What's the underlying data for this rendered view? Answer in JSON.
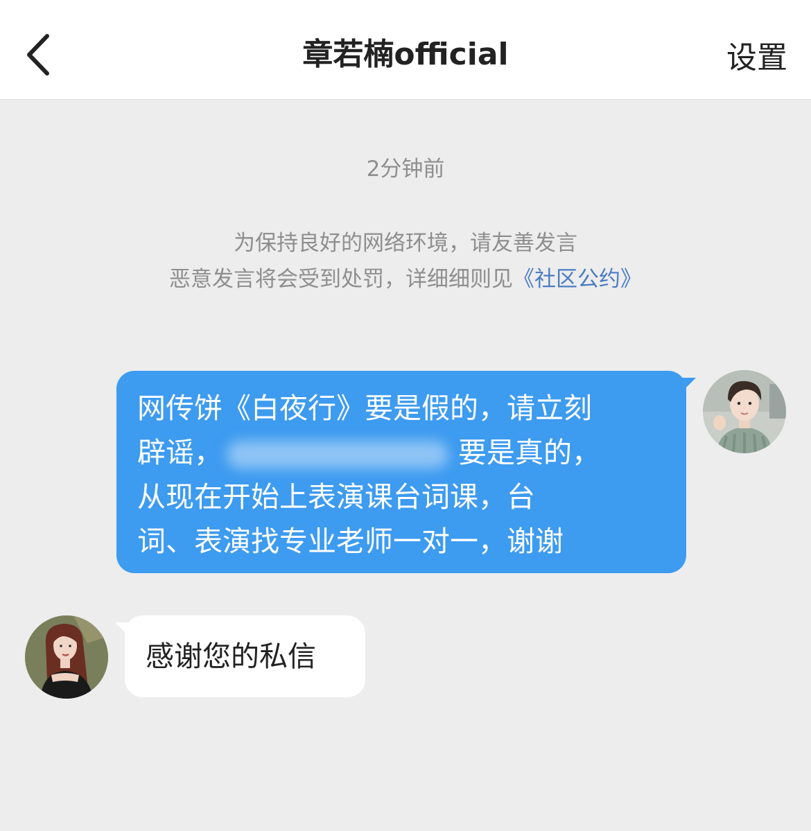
{
  "header": {
    "title": "章若楠official",
    "settings_label": "设置",
    "back_icon": "chevron-left-icon"
  },
  "chat": {
    "timestamp": "2分钟前",
    "notice": {
      "line1": "为保持良好的网络环境，请友善发言",
      "line2_text": "恶意发言将会受到处罚，详细细则见",
      "line2_link": "《社区公约》"
    },
    "messages": [
      {
        "sender": "me",
        "lines": [
          "网传饼《白夜行》要是假的，请立刻",
          "辟谣，",
          "要是真的，",
          "从现在开始上表演课台词课，台",
          "词、表演找专业老师一对一，谢谢"
        ],
        "bubble_color": "#3d9bf0"
      },
      {
        "sender": "them",
        "text": "感谢您的私信",
        "bubble_color": "#ffffff"
      }
    ]
  },
  "colors": {
    "background": "#ededed",
    "link": "#4a7cc2",
    "muted_text": "#8e8e8e"
  }
}
